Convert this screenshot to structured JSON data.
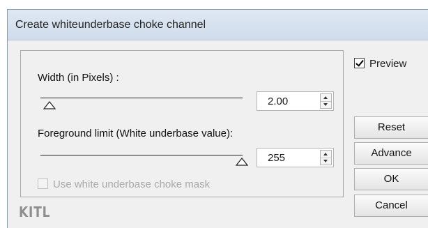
{
  "dialog": {
    "title": "Create whiteunderbase choke channel"
  },
  "width_control": {
    "label": "Width (in Pixels) :",
    "value": "2.00",
    "slider_level": 0.03
  },
  "foreground_control": {
    "label": "Foreground limit (White underbase value):",
    "value": "255",
    "slider_level": 1.0
  },
  "mask_checkbox": {
    "label": "Use white underbase choke mask",
    "checked": false,
    "enabled": false
  },
  "preview_checkbox": {
    "label": "Preview",
    "checked": true
  },
  "buttons": {
    "reset": "Reset",
    "advance": "Advance",
    "ok": "OK",
    "cancel": "Cancel"
  },
  "logo": "KITL",
  "annotation": {
    "arrow_color": "#e01b1b",
    "points_to": "width-spinbox"
  }
}
